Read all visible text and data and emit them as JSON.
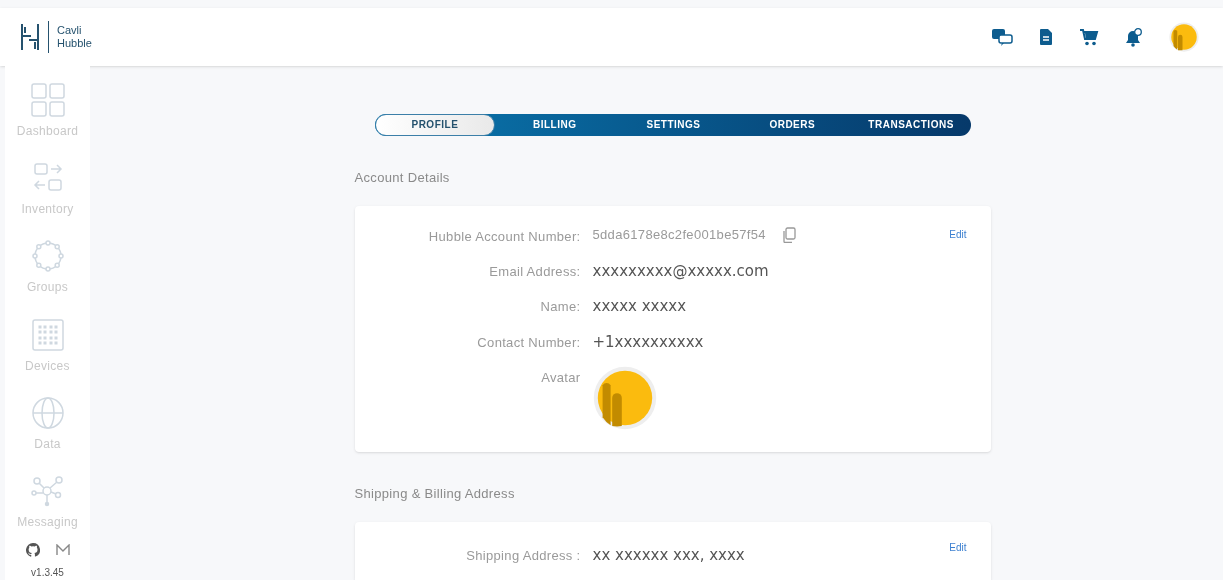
{
  "brand": {
    "line1": "Cavli",
    "line2": "Hubble"
  },
  "sidebar": {
    "items": [
      {
        "label": "Dashboard"
      },
      {
        "label": "Inventory"
      },
      {
        "label": "Groups"
      },
      {
        "label": "Devices"
      },
      {
        "label": "Data"
      },
      {
        "label": "Messaging"
      }
    ],
    "version": "v1.3.45"
  },
  "tabs": [
    {
      "label": "PROFILE",
      "selected": true
    },
    {
      "label": "BILLING",
      "selected": false
    },
    {
      "label": "SETTINGS",
      "selected": false
    },
    {
      "label": "ORDERS",
      "selected": false
    },
    {
      "label": "TRANSACTIONS",
      "selected": false
    }
  ],
  "account": {
    "title": "Account Details",
    "edit": "Edit",
    "fields": [
      {
        "kind": "id",
        "label": "Hubble Account Number:",
        "value": "5dda6178e8c2fe001be57f54"
      },
      {
        "kind": "text",
        "label": "Email Address:",
        "value": "xxxxxxxxx@xxxxx.com"
      },
      {
        "kind": "text",
        "label": "Name:",
        "value": "xxxxx xxxxx"
      },
      {
        "kind": "text",
        "label": "Contact Number:",
        "value": "+1xxxxxxxxxx"
      },
      {
        "kind": "avatar",
        "label": "Avatar"
      }
    ]
  },
  "shipping": {
    "title": "Shipping & Billing Address",
    "edit": "Edit",
    "fields": [
      {
        "kind": "text",
        "label": "Shipping Address :",
        "value": "xx xxxxxx xxx, xxxx"
      }
    ]
  }
}
